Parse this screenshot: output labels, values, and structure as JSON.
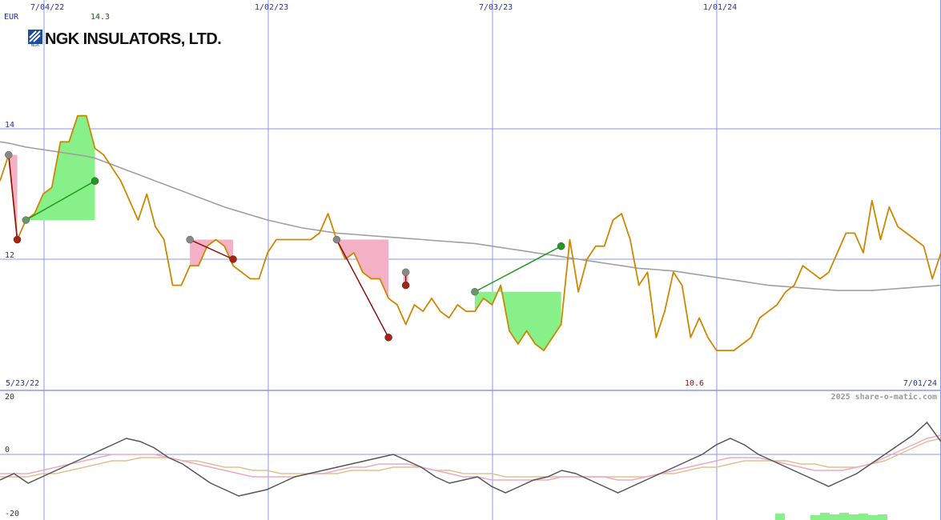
{
  "logo": {
    "name": "NGK INSULATORS, LTD.",
    "mark_text": "NGK"
  },
  "currency": "EUR",
  "top_dates": [
    "7/04/22",
    "1/02/23",
    "7/03/23",
    "1/01/24"
  ],
  "range": {
    "start": "5/23/22",
    "end": "7/01/24"
  },
  "price_max_label": "14.3",
  "price_min_label": "10.6",
  "copyright": "2025 share-o-matic.com",
  "colors": {
    "price": "#cc8800",
    "moving_average": "#a0a0a0",
    "grid": "#8899ee",
    "gain": "#88f088",
    "loss": "#f4b0c4",
    "gain_marker": "#229922",
    "loss_marker": "#aa2211",
    "neutral_marker": "#888888",
    "osc_main": "#555555",
    "osc_signal1": "#f0a8c0",
    "osc_signal2": "#e0c090",
    "logo_blue": "#1a4c9c"
  },
  "chart_data": [
    {
      "type": "line",
      "title": "",
      "ylabel": "EUR",
      "ylim": [
        10.0,
        16.0
      ],
      "yticks": [
        12,
        14
      ],
      "grid": true,
      "x": [
        0,
        1,
        2,
        3,
        4,
        5,
        6,
        7,
        8,
        9,
        10,
        11,
        12,
        13,
        14,
        15,
        16,
        17,
        18,
        19,
        20,
        21,
        22,
        23,
        24,
        25,
        26,
        27,
        28,
        29,
        30,
        31,
        32,
        33,
        34,
        35,
        36,
        37,
        38,
        39,
        40,
        41,
        42,
        43,
        44,
        45,
        46,
        47,
        48,
        49,
        50,
        51,
        52,
        53,
        54,
        55,
        56,
        57,
        58,
        59,
        60,
        61,
        62,
        63,
        64,
        65,
        66,
        67,
        68,
        69,
        70,
        71,
        72,
        73,
        74,
        75,
        76,
        77,
        78,
        79,
        80,
        81,
        82,
        83,
        84,
        85,
        86,
        87,
        88,
        89,
        90,
        91,
        92,
        93,
        94,
        95,
        96,
        97,
        98,
        99,
        100,
        101,
        102,
        103,
        104,
        105,
        106,
        107,
        108,
        109
      ],
      "series": [
        {
          "name": "",
          "values": [
            13.2,
            13.6,
            12.3,
            12.6,
            12.7,
            13.0,
            13.1,
            13.8,
            13.8,
            14.2,
            14.2,
            13.7,
            13.6,
            13.4,
            13.2,
            12.9,
            12.6,
            13.0,
            12.5,
            12.3,
            11.6,
            11.6,
            11.9,
            11.9,
            12.2,
            12.3,
            12.2,
            11.9,
            11.8,
            11.7,
            11.7,
            12.1,
            12.3,
            12.3,
            12.3,
            12.3,
            12.3,
            12.4,
            12.7,
            12.3,
            12.0,
            12.1,
            11.8,
            11.7,
            11.7,
            11.4,
            11.3,
            11.0,
            11.3,
            11.2,
            11.4,
            11.2,
            11.1,
            11.3,
            11.2,
            11.2,
            11.4,
            11.3,
            11.6,
            10.9,
            10.7,
            10.9,
            10.7,
            10.6,
            10.8,
            11.0,
            12.3,
            11.5,
            12.0,
            12.2,
            12.2,
            12.6,
            12.7,
            12.3,
            11.6,
            11.8,
            10.8,
            11.2,
            11.8,
            11.6,
            10.8,
            11.1,
            10.8,
            10.6,
            10.6,
            10.6,
            10.7,
            10.8,
            11.1,
            11.2,
            11.3,
            11.5,
            11.6,
            11.9,
            11.8,
            11.7,
            11.8,
            12.1,
            12.4,
            12.4,
            12.1,
            12.9,
            12.3,
            12.8,
            12.5,
            12.4,
            12.3,
            12.2,
            11.7,
            12.1
          ]
        },
        {
          "name": "",
          "values": [
            13.8,
            13.78,
            13.75,
            13.72,
            13.7,
            13.68,
            13.66,
            13.64,
            13.62,
            13.6,
            13.58,
            13.55,
            13.5,
            13.45,
            13.4,
            13.35,
            13.3,
            13.25,
            13.2,
            13.15,
            13.1,
            13.05,
            13.0,
            12.95,
            12.9,
            12.85,
            12.8,
            12.76,
            12.72,
            12.68,
            12.64,
            12.6,
            12.57,
            12.54,
            12.51,
            12.48,
            12.46,
            12.44,
            12.42,
            12.4,
            12.39,
            12.38,
            12.37,
            12.36,
            12.35,
            12.34,
            12.33,
            12.32,
            12.31,
            12.3,
            12.29,
            12.28,
            12.27,
            12.26,
            12.25,
            12.24,
            12.22,
            12.2,
            12.18,
            12.16,
            12.14,
            12.12,
            12.1,
            12.08,
            12.06,
            12.04,
            12.02,
            12.0,
            11.98,
            11.96,
            11.94,
            11.92,
            11.9,
            11.88,
            11.86,
            11.85,
            11.84,
            11.83,
            11.82,
            11.8,
            11.78,
            11.76,
            11.74,
            11.72,
            11.7,
            11.68,
            11.66,
            11.64,
            11.62,
            11.6,
            11.59,
            11.58,
            11.57,
            11.56,
            11.55,
            11.54,
            11.53,
            11.52,
            11.52,
            11.52,
            11.52,
            11.52,
            11.53,
            11.54,
            11.55,
            11.56,
            11.57,
            11.58,
            11.59,
            11.6
          ]
        }
      ],
      "trades": [
        {
          "from": {
            "x": 1,
            "y": 13.6
          },
          "to": {
            "x": 2,
            "y": 12.3
          },
          "result": "loss"
        },
        {
          "from": {
            "x": 3,
            "y": 12.6
          },
          "to": {
            "x": 11,
            "y": 13.2
          },
          "result": "gain"
        },
        {
          "from": {
            "x": 22,
            "y": 12.3
          },
          "to": {
            "x": 27,
            "y": 12.0
          },
          "result": "loss"
        },
        {
          "from": {
            "x": 39,
            "y": 12.3
          },
          "to": {
            "x": 45,
            "y": 10.8
          },
          "result": "loss"
        },
        {
          "from": {
            "x": 47,
            "y": 11.8
          },
          "to": {
            "x": 47,
            "y": 11.6
          },
          "result": "loss"
        },
        {
          "from": {
            "x": 55,
            "y": 11.5
          },
          "to": {
            "x": 65,
            "y": 12.2
          },
          "result": "gain"
        }
      ]
    },
    {
      "type": "line",
      "title": "",
      "ylim": [
        -20,
        20
      ],
      "yticks": [
        -20,
        0,
        20
      ],
      "grid": true,
      "x": [
        0,
        1,
        2,
        3,
        4,
        5,
        6,
        7,
        8,
        9,
        10,
        11,
        12,
        13,
        14,
        15,
        16,
        17,
        18,
        19,
        20,
        21,
        22,
        23,
        24,
        25,
        26,
        27,
        28,
        29,
        30,
        31,
        32,
        33,
        34,
        35,
        36,
        37,
        38,
        39,
        40,
        41,
        42,
        43,
        44,
        45,
        46,
        47,
        48,
        49,
        50,
        51,
        52,
        53,
        54,
        55,
        56,
        57,
        58,
        59,
        60,
        61,
        62,
        63,
        64,
        65,
        66,
        67
      ],
      "series": [
        {
          "name": "",
          "values": [
            -8,
            -6,
            -9,
            -7,
            -5,
            -3,
            -1,
            1,
            3,
            5,
            4,
            2,
            -1,
            -3,
            -6,
            -9,
            -11,
            -13,
            -12,
            -11,
            -9,
            -7,
            -6,
            -5,
            -4,
            -3,
            -2,
            -1,
            0,
            -2,
            -4,
            -7,
            -9,
            -8,
            -7,
            -10,
            -12,
            -10,
            -8,
            -7,
            -5,
            -6,
            -8,
            -10,
            -12,
            -10,
            -8,
            -6,
            -4,
            -2,
            0,
            3,
            5,
            3,
            0,
            -2,
            -4,
            -6,
            -8,
            -10,
            -8,
            -6,
            -3,
            0,
            3,
            6,
            10,
            4
          ]
        },
        {
          "name": "",
          "values": [
            -6,
            -6,
            -6,
            -5,
            -4,
            -3,
            -2,
            -1,
            0,
            0,
            0,
            0,
            -1,
            -2,
            -3,
            -4,
            -5,
            -6,
            -7,
            -7,
            -7,
            -7,
            -6,
            -6,
            -5,
            -4,
            -4,
            -3,
            -3,
            -3,
            -4,
            -5,
            -6,
            -7,
            -7,
            -8,
            -8,
            -8,
            -8,
            -8,
            -7,
            -7,
            -7,
            -7,
            -8,
            -8,
            -7,
            -6,
            -5,
            -4,
            -3,
            -2,
            -1,
            -1,
            -1,
            -2,
            -3,
            -4,
            -5,
            -5,
            -5,
            -4,
            -3,
            -1,
            1,
            3,
            5,
            6
          ]
        },
        {
          "name": "",
          "values": [
            -7,
            -7,
            -7,
            -6,
            -6,
            -5,
            -4,
            -3,
            -2,
            -2,
            -1,
            -1,
            -1,
            -2,
            -2,
            -3,
            -4,
            -4,
            -5,
            -5,
            -6,
            -6,
            -6,
            -6,
            -6,
            -5,
            -5,
            -5,
            -4,
            -4,
            -4,
            -5,
            -5,
            -6,
            -6,
            -6,
            -7,
            -7,
            -7,
            -7,
            -7,
            -7,
            -7,
            -7,
            -7,
            -7,
            -7,
            -6,
            -6,
            -5,
            -4,
            -4,
            -3,
            -2,
            -2,
            -2,
            -2,
            -3,
            -3,
            -4,
            -4,
            -4,
            -3,
            -2,
            0,
            2,
            4,
            5
          ]
        }
      ]
    }
  ]
}
